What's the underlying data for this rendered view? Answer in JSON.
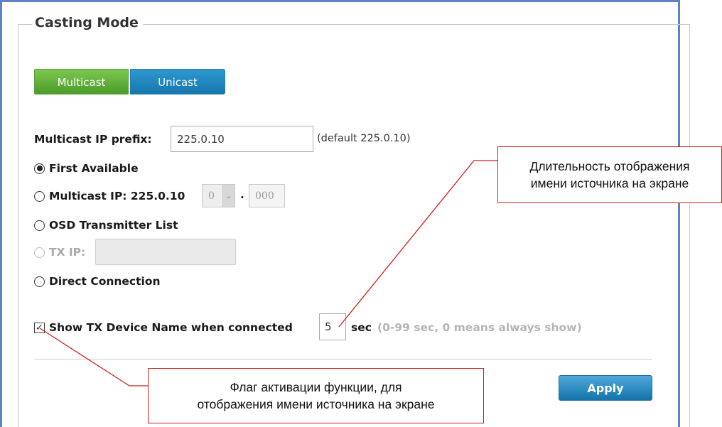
{
  "section": {
    "title": "Casting Mode"
  },
  "tabs": [
    {
      "label": "Multicast",
      "active": true
    },
    {
      "label": "Unicast",
      "active": false
    }
  ],
  "multicast_prefix": {
    "label": "Multicast IP prefix:",
    "value": "225.0.10",
    "hint": "(default 225.0.10)"
  },
  "options": {
    "first_available": {
      "label": "First Available",
      "selected": true
    },
    "multicast_ip": {
      "label": "Multicast IP: 225.0.10",
      "select_value": "0",
      "separator": ".",
      "last_octet": "000",
      "selected": false
    },
    "osd_list": {
      "label": "OSD Transmitter List",
      "selected": false
    },
    "tx_ip": {
      "label": "TX IP:",
      "value": "",
      "disabled": true
    },
    "direct": {
      "label": "Direct Connection",
      "selected": false
    }
  },
  "show_name": {
    "checked": true,
    "label": "Show TX Device Name when connected",
    "value": "5",
    "unit": "sec",
    "hint": "(0-99 sec, 0 means always show)"
  },
  "apply_label": "Apply",
  "callouts": {
    "duration": {
      "line1": "Длительность отображения",
      "line2": "имени источника на экране"
    },
    "flag": {
      "line1": "Флаг активации функции, для",
      "line2": "отображения имени источника на экране"
    }
  },
  "colors": {
    "frame": "#5f83c2",
    "multicast_tab": "#5aa23a",
    "unicast_tab": "#1677ae",
    "apply": "#1573aa",
    "callout_border": "#cf1f1f"
  }
}
